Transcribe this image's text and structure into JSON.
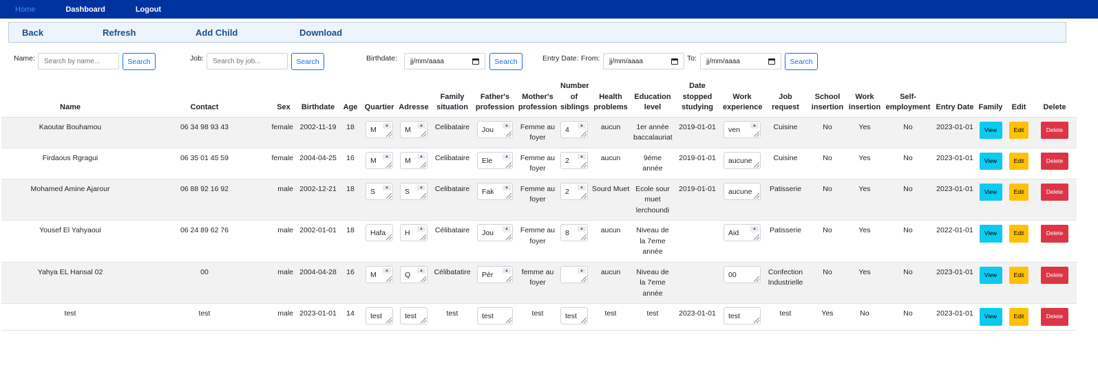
{
  "nav": {
    "home": "Home",
    "dashboard": "Dashboard",
    "logout": "Logout"
  },
  "actions": {
    "back": "Back",
    "refresh": "Refresh",
    "add_child": "Add Child",
    "download": "Download"
  },
  "filters": {
    "name_label": "Name:",
    "name_placeholder": "Search by name...",
    "job_label": "Job:",
    "job_placeholder": "Search by job...",
    "birthdate_label": "Birthdate:",
    "date_placeholder": "jj/mm/aaaa",
    "entry_label": "Entry Date:",
    "from_label": "From:",
    "to_label": "To:",
    "search": "Search"
  },
  "columns": [
    "Name",
    "Contact",
    "Sex",
    "Birthdate",
    "Age",
    "Quartier",
    "Adresse",
    "Family situation",
    "Father's profession",
    "Mother's profession",
    "Number of siblings",
    "Health problems",
    "Education level",
    "Date stopped studying",
    "Work experience",
    "Job request",
    "School insertion",
    "Work insertion",
    "Self-employment",
    "Entry Date",
    "Family",
    "Edit",
    "Delete"
  ],
  "buttons": {
    "view": "View",
    "edit": "Edit",
    "delete": "Delete"
  },
  "rows": [
    {
      "name": "Kaoutar Bouhamou",
      "contact": "06 34 98 93 43",
      "sex": "female",
      "birthdate": "2002-11-19",
      "age": "18",
      "quartier": "M",
      "adresse": "M",
      "family": "Celibataire",
      "father": "Jou",
      "mother": "Femme au foyer",
      "siblings": "4",
      "health": "aucun",
      "education": "1er année baccalauriat",
      "stopped": "2019-01-01",
      "work": "ven",
      "job": "Cuisine",
      "school": "No",
      "winsert": "Yes",
      "selfemp": "No",
      "entry": "2023-01-01"
    },
    {
      "name": "Firdaous Rgragui",
      "contact": "06 35 01 45 59",
      "sex": "female",
      "birthdate": "2004-04-25",
      "age": "16",
      "quartier": "M",
      "adresse": "M",
      "family": "Celibataire",
      "father": "Ele",
      "mother": "Femme au foyer",
      "siblings": "2",
      "health": "aucun",
      "education": "9éme année",
      "stopped": "2019-01-01",
      "work": "aucune",
      "job": "Cuisine",
      "school": "No",
      "winsert": "Yes",
      "selfemp": "No",
      "entry": "2023-01-01"
    },
    {
      "name": "Mohamed Amine Ajarour",
      "contact": "06 88 92 16 92",
      "sex": "male",
      "birthdate": "2002-12-21",
      "age": "18",
      "quartier": "S",
      "adresse": "S",
      "family": "Celibataire",
      "father": "Fak",
      "mother": "Femme au foyer",
      "siblings": "2",
      "health": "Sourd Muet",
      "education": "Ecole sour muet lerchoundi",
      "stopped": "2019-01-01",
      "work": "aucune",
      "job": "Patisserie",
      "school": "No",
      "winsert": "Yes",
      "selfemp": "No",
      "entry": "2023-01-01"
    },
    {
      "name": "Yousef El Yahyaoui",
      "contact": "06 24 89 62 76",
      "sex": "male",
      "birthdate": "2002-01-01",
      "age": "18",
      "quartier": "Hafa",
      "adresse": "H",
      "family": "Célibataire",
      "father": "Jou",
      "mother": "Femme au foyer",
      "siblings": "8",
      "health": "aucun",
      "education": "Niveau de la 7eme année",
      "stopped": "",
      "work": "Aid",
      "job": "Patisserie",
      "school": "No",
      "winsert": "Yes",
      "selfemp": "No",
      "entry": "2022-01-01"
    },
    {
      "name": "Yahya EL Hansal 02",
      "contact": "00",
      "sex": "male",
      "birthdate": "2004-04-28",
      "age": "16",
      "quartier": "M",
      "adresse": "Q",
      "family": "Célibatatire",
      "father": "Pèr",
      "mother": "femme au foyer",
      "siblings": "",
      "health": "aucun",
      "education": "Niveau de la 7eme année",
      "stopped": "",
      "work": "00",
      "job": "Confection Industrielle",
      "school": "No",
      "winsert": "Yes",
      "selfemp": "No",
      "entry": "2023-01-01"
    },
    {
      "name": "test",
      "contact": "test",
      "sex": "male",
      "birthdate": "2023-01-01",
      "age": "14",
      "quartier": "test",
      "adresse": "test",
      "family": "test",
      "father": "test",
      "mother": "test",
      "siblings": "test",
      "health": "test",
      "education": "test",
      "stopped": "2023-01-01",
      "work": "test",
      "job": "test",
      "school": "Yes",
      "winsert": "No",
      "selfemp": "No",
      "entry": "2023-01-01"
    }
  ]
}
